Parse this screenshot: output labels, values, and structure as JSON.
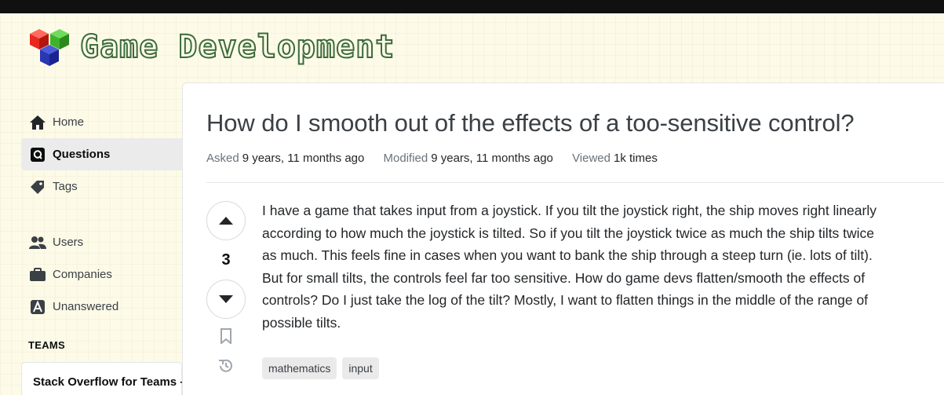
{
  "site": {
    "name": "Game Development"
  },
  "nav": {
    "home": "Home",
    "questions": "Questions",
    "tags": "Tags",
    "users": "Users",
    "companies": "Companies",
    "unanswered": "Unanswered",
    "teams_heading": "TEAMS",
    "teams_card": "Stack Overflow for Teams – Start"
  },
  "question": {
    "title": "How do I smooth out of the effects of a too-sensitive control?",
    "asked_label": "Asked",
    "asked_value": "9 years, 11 months ago",
    "modified_label": "Modified",
    "modified_value": "9 years, 11 months ago",
    "viewed_label": "Viewed",
    "viewed_value": "1k times",
    "votes": "3",
    "body": "I have a game that takes input from a joystick. If you tilt the joystick right, the ship moves right linearly according to how much the joystick is tilted. So if you tilt the joystick twice as much the ship tilts twice as much. This feels fine in cases when you want to bank the ship through a steep turn (ie. lots of tilt). But for small tilts, the controls feel far too sensitive. How do game devs flatten/smooth the effects of controls? Do I just take the log of the tilt? Mostly, I want to flatten things in the middle of the range of possible tilts.",
    "tags": [
      "mathematics",
      "input"
    ]
  },
  "icons": [
    "home-icon",
    "questions-icon",
    "tag-icon",
    "users-icon",
    "briefcase-icon",
    "unanswered-icon",
    "upvote-icon",
    "downvote-icon",
    "bookmark-icon",
    "history-icon"
  ]
}
